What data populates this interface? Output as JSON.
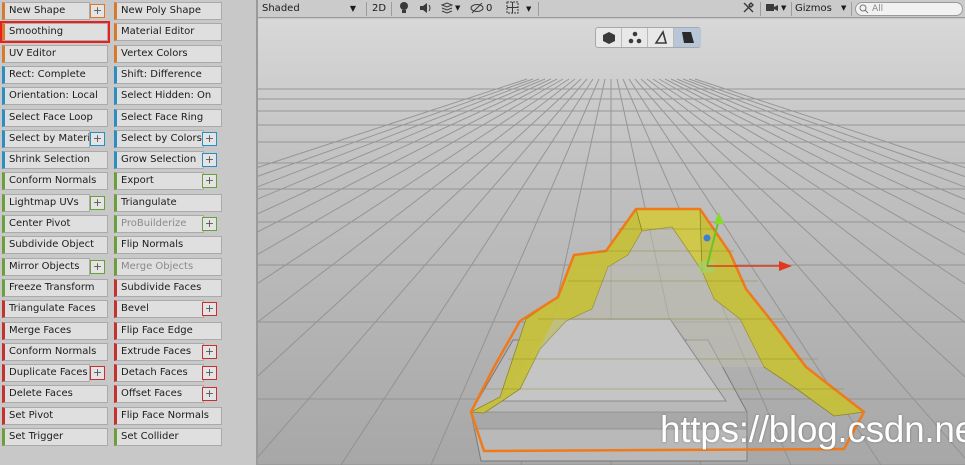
{
  "probuilder": {
    "left_column": [
      {
        "label": "New Shape",
        "color": "orange",
        "plus": true,
        "selected": false,
        "disabled": false
      },
      {
        "label": "Smoothing",
        "color": "orange",
        "plus": false,
        "selected": true,
        "disabled": false
      },
      {
        "label": "UV Editor",
        "color": "orange",
        "plus": false,
        "selected": false,
        "disabled": false
      },
      {
        "label": "Rect: Complete",
        "color": "blue",
        "plus": false,
        "selected": false,
        "disabled": false
      },
      {
        "label": "Orientation: Local",
        "color": "blue",
        "plus": false,
        "selected": false,
        "disabled": false
      },
      {
        "label": "Select Face Loop",
        "color": "blue",
        "plus": false,
        "selected": false,
        "disabled": false
      },
      {
        "label": "Select by Material",
        "color": "blue",
        "plus": true,
        "selected": false,
        "disabled": false
      },
      {
        "label": "Shrink Selection",
        "color": "blue",
        "plus": false,
        "selected": false,
        "disabled": false
      },
      {
        "label": "Conform Normals",
        "color": "green",
        "plus": false,
        "selected": false,
        "disabled": false
      },
      {
        "label": "Lightmap UVs",
        "color": "green",
        "plus": true,
        "selected": false,
        "disabled": false
      },
      {
        "label": "Center Pivot",
        "color": "green",
        "plus": false,
        "selected": false,
        "disabled": false
      },
      {
        "label": "Subdivide Object",
        "color": "green",
        "plus": false,
        "selected": false,
        "disabled": false
      },
      {
        "label": "Mirror Objects",
        "color": "green",
        "plus": true,
        "selected": false,
        "disabled": false
      },
      {
        "label": "Freeze Transform",
        "color": "green",
        "plus": false,
        "selected": false,
        "disabled": false
      },
      {
        "label": "Triangulate Faces",
        "color": "red",
        "plus": false,
        "selected": false,
        "disabled": false
      },
      {
        "label": "Merge Faces",
        "color": "red",
        "plus": false,
        "selected": false,
        "disabled": false
      },
      {
        "label": "Conform Normals",
        "color": "red",
        "plus": false,
        "selected": false,
        "disabled": false
      },
      {
        "label": "Duplicate Faces",
        "color": "red",
        "plus": true,
        "selected": false,
        "disabled": false
      },
      {
        "label": "Delete Faces",
        "color": "red",
        "plus": false,
        "selected": false,
        "disabled": false
      },
      {
        "label": "Set Pivot",
        "color": "red",
        "plus": false,
        "selected": false,
        "disabled": false
      },
      {
        "label": "Set Trigger",
        "color": "green",
        "plus": false,
        "selected": false,
        "disabled": false
      }
    ],
    "right_column": [
      {
        "label": "New Poly Shape",
        "color": "orange",
        "plus": false,
        "disabled": false
      },
      {
        "label": "Material Editor",
        "color": "orange",
        "plus": false,
        "disabled": false
      },
      {
        "label": "Vertex Colors",
        "color": "orange",
        "plus": false,
        "disabled": false
      },
      {
        "label": "Shift: Difference",
        "color": "blue",
        "plus": false,
        "disabled": false
      },
      {
        "label": "Select Hidden: On",
        "color": "blue",
        "plus": false,
        "disabled": false
      },
      {
        "label": "Select Face Ring",
        "color": "blue",
        "plus": false,
        "disabled": false
      },
      {
        "label": "Select by Colors",
        "color": "blue",
        "plus": true,
        "disabled": false
      },
      {
        "label": "Grow Selection",
        "color": "blue",
        "plus": true,
        "disabled": false
      },
      {
        "label": "Export",
        "color": "green",
        "plus": true,
        "disabled": false
      },
      {
        "label": "Triangulate",
        "color": "green",
        "plus": false,
        "disabled": false
      },
      {
        "label": "ProBuilderize",
        "color": "green",
        "plus": true,
        "disabled": true
      },
      {
        "label": "Flip Normals",
        "color": "green",
        "plus": false,
        "disabled": false
      },
      {
        "label": "Merge Objects",
        "color": "green",
        "plus": false,
        "disabled": true
      },
      {
        "label": "Subdivide Faces",
        "color": "red",
        "plus": false,
        "disabled": false
      },
      {
        "label": "Bevel",
        "color": "red",
        "plus": true,
        "disabled": false
      },
      {
        "label": "Flip Face Edge",
        "color": "red",
        "plus": false,
        "disabled": false
      },
      {
        "label": "Extrude Faces",
        "color": "red",
        "plus": true,
        "disabled": false
      },
      {
        "label": "Detach Faces",
        "color": "red",
        "plus": true,
        "disabled": false
      },
      {
        "label": "Offset Faces",
        "color": "red",
        "plus": true,
        "disabled": false
      },
      {
        "label": "Flip Face Normals",
        "color": "red",
        "plus": false,
        "disabled": false
      },
      {
        "label": "Set Collider",
        "color": "green",
        "plus": false,
        "disabled": false
      }
    ]
  },
  "scene_toolbar": {
    "shading_mode": "Shaded",
    "mode_2d": "2D",
    "hidden_count": "0",
    "gizmos_label": "Gizmos",
    "search_placeholder": "All"
  },
  "colors": {
    "orange": "#d9792b",
    "blue": "#2a8fc0",
    "green": "#6aa037",
    "red": "#c53030",
    "selection_outline": "#e8211e",
    "face_selected": "#c7c13c",
    "mesh_outline": "#f07a1a"
  },
  "watermark": "https://blog.csdn.net/liu_guozhu"
}
